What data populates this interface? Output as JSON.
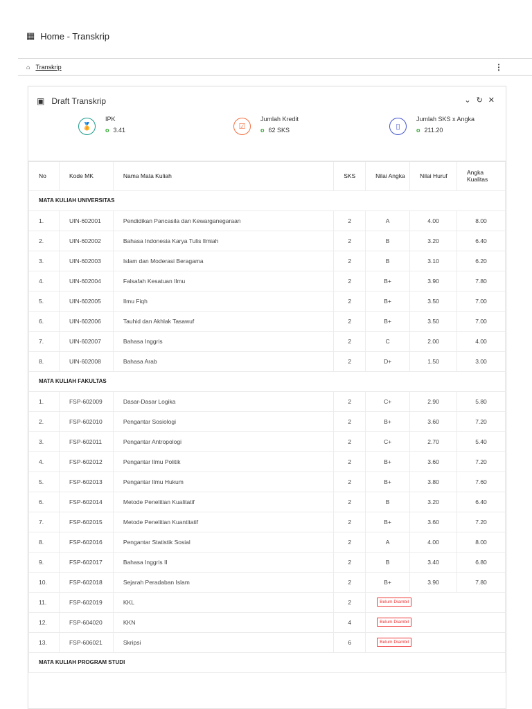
{
  "header": {
    "title": "Home - Transkrip"
  },
  "breadcrumb": {
    "item": "Transkrip"
  },
  "card": {
    "title": "Draft Transkrip",
    "stats": [
      {
        "label": "IPK",
        "value": "3.41",
        "color": "#1a9a8a"
      },
      {
        "label": "Jumlah Kredit",
        "value": "62 SKS",
        "color": "#f07040"
      },
      {
        "label": "Jumlah SKS x Angka",
        "value": "211.20",
        "color": "#4455cc"
      }
    ]
  },
  "table": {
    "headers": [
      "No",
      "Kode MK",
      "Nama Mata Kuliah",
      "SKS",
      "Nilai Angka",
      "Nilai Huruf",
      "Angka Kualitas"
    ],
    "sections": [
      {
        "title": "MATA KULIAH UNIVERSITAS",
        "rows": [
          [
            "1.",
            "UIN-602001",
            "Pendidikan Pancasila dan Kewarganegaraan",
            "2",
            "A",
            "4.00",
            "8.00"
          ],
          [
            "2.",
            "UIN-602002",
            "Bahasa Indonesia Karya Tulis Ilmiah",
            "2",
            "B",
            "3.20",
            "6.40"
          ],
          [
            "3.",
            "UIN-602003",
            "Islam dan Moderasi Beragama",
            "2",
            "B",
            "3.10",
            "6.20"
          ],
          [
            "4.",
            "UIN-602004",
            "Falsafah Kesatuan Ilmu",
            "2",
            "B+",
            "3.90",
            "7.80"
          ],
          [
            "5.",
            "UIN-602005",
            "Ilmu Fiqh",
            "2",
            "B+",
            "3.50",
            "7.00"
          ],
          [
            "6.",
            "UIN-602006",
            "Tauhid dan Akhlak Tasawuf",
            "2",
            "B+",
            "3.50",
            "7.00"
          ],
          [
            "7.",
            "UIN-602007",
            "Bahasa Inggris",
            "2",
            "C",
            "2.00",
            "4.00"
          ],
          [
            "8.",
            "UIN-602008",
            "Bahasa Arab",
            "2",
            "D+",
            "1.50",
            "3.00"
          ]
        ]
      },
      {
        "title": "MATA KULIAH FAKULTAS",
        "rows": [
          [
            "1.",
            "FSP-602009",
            "Dasar-Dasar Logika",
            "2",
            "C+",
            "2.90",
            "5.80"
          ],
          [
            "2.",
            "FSP-602010",
            "Pengantar Sosiologi",
            "2",
            "B+",
            "3.60",
            "7.20"
          ],
          [
            "3.",
            "FSP-602011",
            "Pengantar Antropologi",
            "2",
            "C+",
            "2.70",
            "5.40"
          ],
          [
            "4.",
            "FSP-602012",
            "Pengantar Ilmu Politik",
            "2",
            "B+",
            "3.60",
            "7.20"
          ],
          [
            "5.",
            "FSP-602013",
            "Pengantar Ilmu Hukum",
            "2",
            "B+",
            "3.80",
            "7.60"
          ],
          [
            "6.",
            "FSP-602014",
            "Metode Penelitian Kualitatif",
            "2",
            "B",
            "3.20",
            "6.40"
          ],
          [
            "7.",
            "FSP-602015",
            "Metode Penelitian Kuantitatif",
            "2",
            "B+",
            "3.60",
            "7.20"
          ],
          [
            "8.",
            "FSP-602016",
            "Pengantar Statistik Sosial",
            "2",
            "A",
            "4.00",
            "8.00"
          ],
          [
            "9.",
            "FSP-602017",
            "Bahasa Inggris II",
            "2",
            "B",
            "3.40",
            "6.80"
          ],
          [
            "10.",
            "FSP-602018",
            "Sejarah Peradaban Islam",
            "2",
            "B+",
            "3.90",
            "7.80"
          ],
          [
            "11.",
            "FSP-602019",
            "KKL",
            "2",
            "Belum Diambil"
          ],
          [
            "12.",
            "FSP-604020",
            "KKN",
            "4",
            "Belum Diambil"
          ],
          [
            "13.",
            "FSP-606021",
            "Skripsi",
            "6",
            "Belum Diambil"
          ]
        ]
      },
      {
        "title": "MATA KULIAH PROGRAM STUDI",
        "rows": []
      }
    ]
  }
}
